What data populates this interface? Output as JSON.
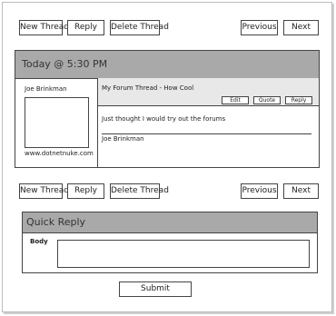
{
  "toolbar_top": {
    "new_thread": "New Thread",
    "reply": "Reply",
    "delete_thread": "Delete Thread",
    "previous": "Previous",
    "next": "Next"
  },
  "post": {
    "header": "Today @ 5:30 PM",
    "author": "Joe Brinkman",
    "website": "www.dotnetnuke.com",
    "subject": "My Forum Thread - How Cool",
    "actions": {
      "edit": "Edit",
      "quote": "Quote",
      "reply": "Reply"
    },
    "body": "Just thought I would try out the forums",
    "signature": "Joe Brinkman"
  },
  "toolbar_bottom": {
    "new_thread": "New Thread",
    "reply": "Reply",
    "delete_thread": "Delete Thread",
    "previous": "Previous",
    "next": "Next"
  },
  "quick_reply": {
    "title": "Quick Reply",
    "body_label": "Body",
    "body_value": "",
    "submit": "Submit"
  }
}
